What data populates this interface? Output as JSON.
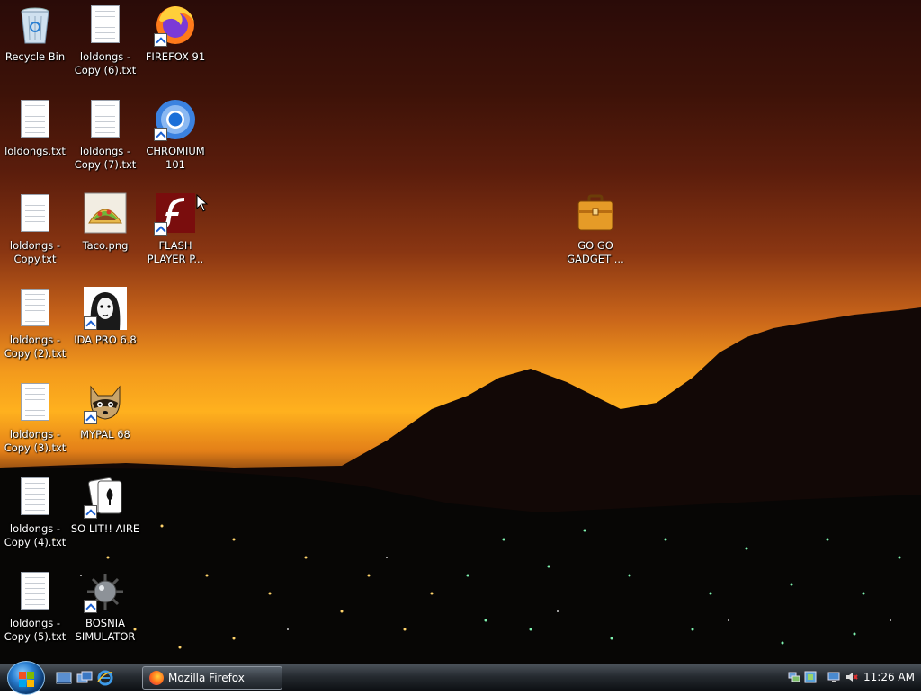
{
  "desktop": {
    "icons": [
      {
        "name": "recycle-bin",
        "label": "Recycle Bin",
        "type": "recycle-bin-icon"
      },
      {
        "name": "loldongs-copy-6",
        "label": "loldongs - Copy (6).txt",
        "type": "text-file-icon"
      },
      {
        "name": "firefox-91",
        "label": "FIREFOX 91",
        "type": "firefox-icon",
        "shortcut": true
      },
      {
        "name": "loldongs",
        "label": "loldongs.txt",
        "type": "text-file-icon"
      },
      {
        "name": "loldongs-copy-7",
        "label": "loldongs - Copy (7).txt",
        "type": "text-file-icon"
      },
      {
        "name": "chromium-101",
        "label": "CHROMIUM 101",
        "type": "chromium-icon",
        "shortcut": true
      },
      {
        "name": "loldongs-copy",
        "label": "loldongs - Copy.txt",
        "type": "text-file-icon"
      },
      {
        "name": "taco",
        "label": "Taco.png",
        "type": "taco-image-icon"
      },
      {
        "name": "flash-player",
        "label": "FLASH PLAYER P...",
        "type": "flash-icon",
        "shortcut": true
      },
      {
        "name": "go-go-gadget",
        "label": "GO GO GADGET ...",
        "type": "briefcase-icon"
      },
      {
        "name": "loldongs-copy-2",
        "label": "loldongs - Copy (2).txt",
        "type": "text-file-icon"
      },
      {
        "name": "ida-pro",
        "label": "IDA PRO 6.8",
        "type": "ida-icon",
        "shortcut": true
      },
      {
        "name": "loldongs-copy-3",
        "label": "loldongs - Copy (3).txt",
        "type": "text-file-icon"
      },
      {
        "name": "mypal-68",
        "label": "MYPAL 68",
        "type": "raccoon-icon",
        "shortcut": true
      },
      {
        "name": "loldongs-copy-4",
        "label": "loldongs - Copy (4).txt",
        "type": "text-file-icon"
      },
      {
        "name": "solitaire",
        "label": "SO LIT!! AIRE",
        "type": "cards-icon",
        "shortcut": true
      },
      {
        "name": "loldongs-copy-5",
        "label": "loldongs - Copy (5).txt",
        "type": "text-file-icon"
      },
      {
        "name": "bosnia-simulator",
        "label": "BOSNIA SIMULATOR",
        "type": "mine-icon",
        "shortcut": true
      }
    ]
  },
  "taskbar": {
    "start_button": "start-orb-icon",
    "quick_launch": [
      "show-desktop-icon",
      "switch-windows-icon",
      "internet-explorer-icon"
    ],
    "tasks": [
      {
        "label": "Mozilla Firefox",
        "icon": "firefox-icon"
      }
    ],
    "tray_icons": [
      "network-icon",
      "connection-icon",
      "display-icon",
      "volume-muted-icon"
    ],
    "clock": "11:26 AM"
  },
  "colors": {
    "taskbar": "#1e2328",
    "sky_top": "#2a0b08",
    "horizon": "#ffb11e"
  }
}
